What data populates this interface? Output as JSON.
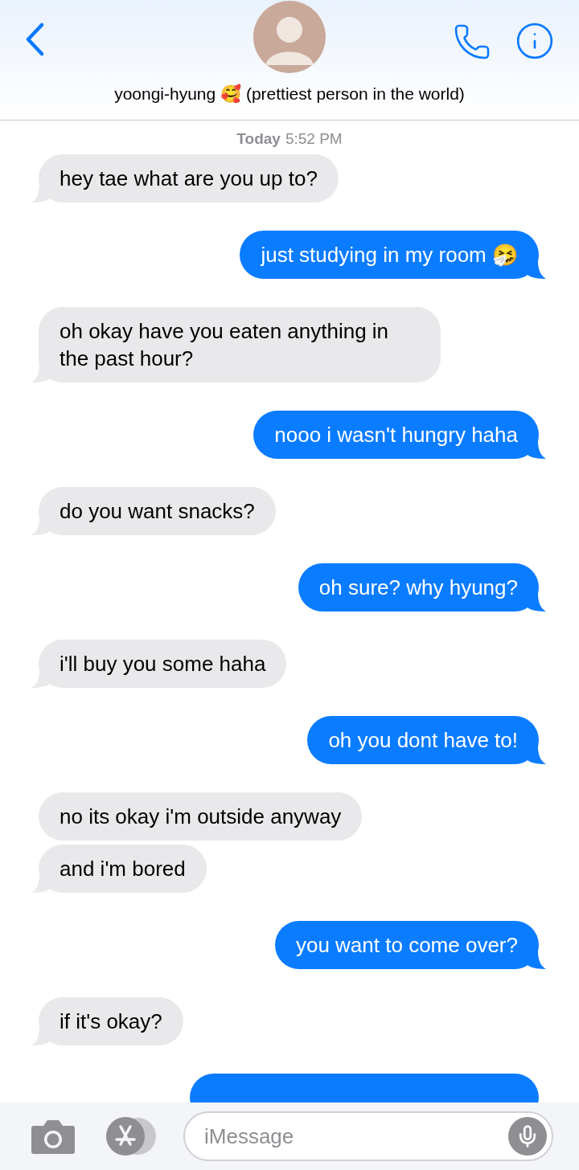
{
  "header": {
    "name": "yoongi-hyung 🥰 (prettiest person in the world)"
  },
  "timestamp": {
    "day": "Today",
    "time": "5:52 PM"
  },
  "messages": [
    {
      "kind": "received",
      "text": "hey tae what are you up to?",
      "tail": true
    },
    {
      "kind": "sent",
      "text": "just studying in my room 🤧",
      "tail": true
    },
    {
      "kind": "received",
      "text": "oh okay have you eaten anything in the past hour?",
      "tail": true
    },
    {
      "kind": "sent",
      "text": "nooo i wasn't hungry haha",
      "tail": true
    },
    {
      "kind": "received",
      "text": "do you want snacks?",
      "tail": true
    },
    {
      "kind": "sent",
      "text": "oh sure? why hyung?",
      "tail": true
    },
    {
      "kind": "received",
      "text": "i'll buy you some haha",
      "tail": true
    },
    {
      "kind": "sent",
      "text": "oh you dont have to!",
      "tail": true
    },
    {
      "kind": "received",
      "text": "no its okay i'm outside anyway",
      "tail": false
    },
    {
      "kind": "received",
      "text": "and i'm bored",
      "tail": true
    },
    {
      "kind": "sent",
      "text": "you want to come over?",
      "tail": true
    },
    {
      "kind": "received",
      "text": "if it's okay?",
      "tail": true
    },
    {
      "kind": "sent",
      "tail": false
    }
  ],
  "composer": {
    "placeholder": "iMessage"
  }
}
